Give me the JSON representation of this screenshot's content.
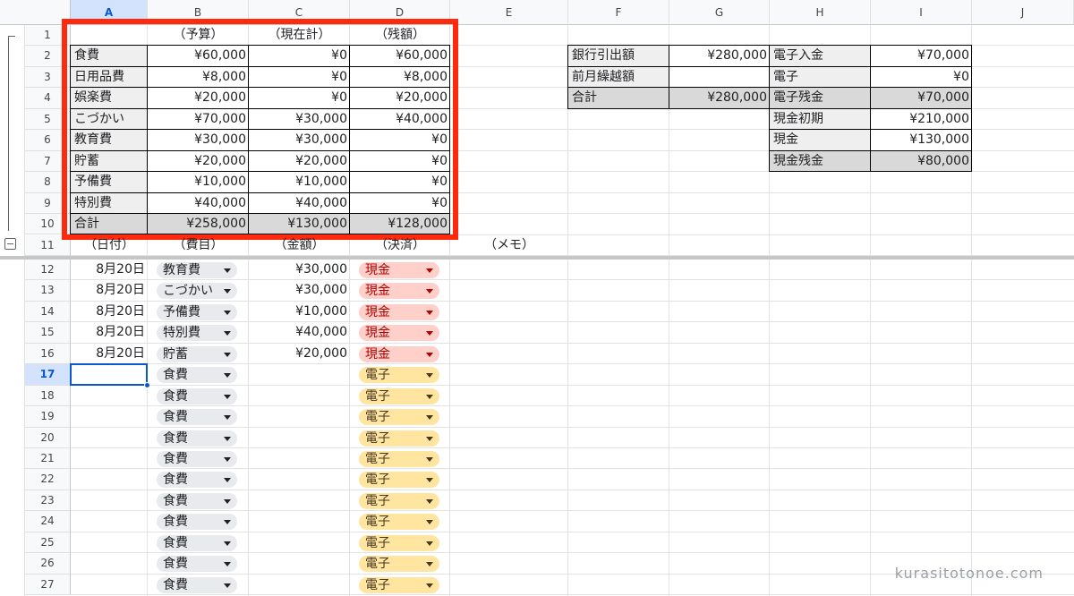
{
  "columns": [
    "A",
    "B",
    "C",
    "D",
    "E",
    "F",
    "G",
    "H",
    "I",
    "J"
  ],
  "selected_column": "A",
  "selected_row": "17",
  "rows": [
    "1",
    "2",
    "3",
    "4",
    "5",
    "6",
    "7",
    "8",
    "9",
    "10",
    "11",
    "12",
    "13",
    "14",
    "15",
    "16",
    "17",
    "18",
    "19",
    "20",
    "21",
    "22",
    "23",
    "24",
    "25",
    "26",
    "27"
  ],
  "budget_table": {
    "headers": [
      "（予算）",
      "（現在計）",
      "（残額）"
    ],
    "items": [
      {
        "name": "食費",
        "budget": "¥60,000",
        "current": "¥0",
        "remain": "¥60,000"
      },
      {
        "name": "日用品費",
        "budget": "¥8,000",
        "current": "¥0",
        "remain": "¥8,000"
      },
      {
        "name": "娯楽費",
        "budget": "¥20,000",
        "current": "¥0",
        "remain": "¥20,000"
      },
      {
        "name": "こづかい",
        "budget": "¥70,000",
        "current": "¥30,000",
        "remain": "¥40,000"
      },
      {
        "name": "教育費",
        "budget": "¥30,000",
        "current": "¥30,000",
        "remain": "¥0"
      },
      {
        "name": "貯蓄",
        "budget": "¥20,000",
        "current": "¥20,000",
        "remain": "¥0"
      },
      {
        "name": "予備費",
        "budget": "¥10,000",
        "current": "¥10,000",
        "remain": "¥0"
      },
      {
        "name": "特別費",
        "budget": "¥40,000",
        "current": "¥40,000",
        "remain": "¥0"
      },
      {
        "name": "合計",
        "budget": "¥258,000",
        "current": "¥130,000",
        "remain": "¥128,000"
      }
    ]
  },
  "bank_table": [
    {
      "label": "銀行引出額",
      "value": "¥280,000"
    },
    {
      "label": "前月繰越額",
      "value": ""
    },
    {
      "label": "合計",
      "value": "¥280,000"
    }
  ],
  "cash_table": [
    {
      "label": "電子入金",
      "value": "¥70,000"
    },
    {
      "label": "電子",
      "value": "¥0"
    },
    {
      "label": "電子残金",
      "value": "¥70,000"
    },
    {
      "label": "現金初期",
      "value": "¥210,000"
    },
    {
      "label": "現金",
      "value": "¥130,000"
    },
    {
      "label": "現金残金",
      "value": "¥80,000"
    }
  ],
  "log_headers": [
    "（日付）",
    "（費目）",
    "（金額）",
    "（決済）",
    "（メモ）"
  ],
  "log_rows": [
    {
      "date": "8月20日",
      "category": "教育費",
      "amount": "¥30,000",
      "payment": "現金",
      "pay_style": "red"
    },
    {
      "date": "8月20日",
      "category": "こづかい",
      "amount": "¥30,000",
      "payment": "現金",
      "pay_style": "red"
    },
    {
      "date": "8月20日",
      "category": "予備費",
      "amount": "¥10,000",
      "payment": "現金",
      "pay_style": "red"
    },
    {
      "date": "8月20日",
      "category": "特別費",
      "amount": "¥40,000",
      "payment": "現金",
      "pay_style": "red"
    },
    {
      "date": "8月20日",
      "category": "貯蓄",
      "amount": "¥20,000",
      "payment": "現金",
      "pay_style": "red"
    },
    {
      "date": "",
      "category": "食費",
      "amount": "",
      "payment": "電子",
      "pay_style": "yellow"
    },
    {
      "date": "",
      "category": "食費",
      "amount": "",
      "payment": "電子",
      "pay_style": "yellow"
    },
    {
      "date": "",
      "category": "食費",
      "amount": "",
      "payment": "電子",
      "pay_style": "yellow"
    },
    {
      "date": "",
      "category": "食費",
      "amount": "",
      "payment": "電子",
      "pay_style": "yellow"
    },
    {
      "date": "",
      "category": "食費",
      "amount": "",
      "payment": "電子",
      "pay_style": "yellow"
    },
    {
      "date": "",
      "category": "食費",
      "amount": "",
      "payment": "電子",
      "pay_style": "yellow"
    },
    {
      "date": "",
      "category": "食費",
      "amount": "",
      "payment": "電子",
      "pay_style": "yellow"
    },
    {
      "date": "",
      "category": "食費",
      "amount": "",
      "payment": "電子",
      "pay_style": "yellow"
    },
    {
      "date": "",
      "category": "食費",
      "amount": "",
      "payment": "電子",
      "pay_style": "yellow"
    },
    {
      "date": "",
      "category": "食費",
      "amount": "",
      "payment": "電子",
      "pay_style": "yellow"
    },
    {
      "date": "",
      "category": "食費",
      "amount": "",
      "payment": "電子",
      "pay_style": "yellow"
    }
  ],
  "colors": {
    "highlight_box": "#ff2a0d",
    "selection": "#0b57d0",
    "cash_chip": "#ffcfc9",
    "electronic_chip": "#ffe5a0",
    "category_chip": "#e8eaed"
  },
  "icons": {
    "group_collapse": "minus-box-icon",
    "dropdown": "triangle-down-icon"
  },
  "watermark": "kurasitotonoe.com"
}
